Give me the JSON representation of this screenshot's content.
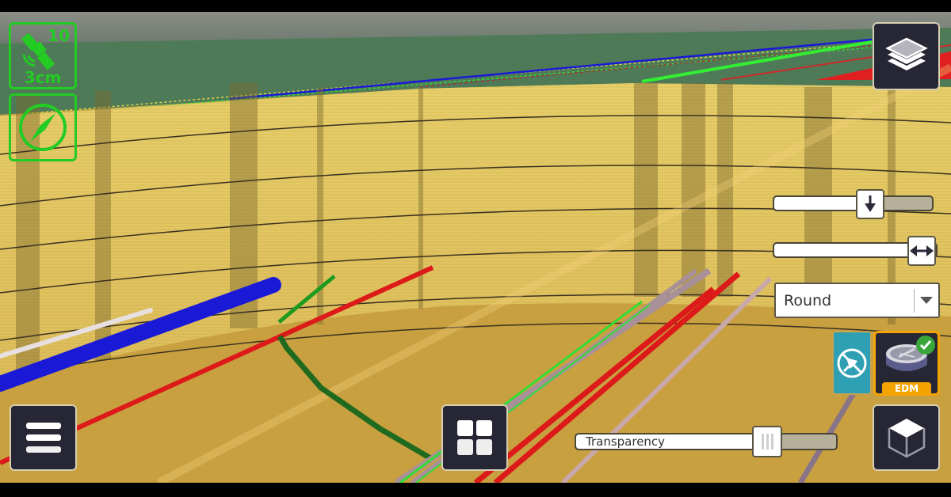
{
  "app": {
    "type": "AR utility viewer",
    "view_mode": "excavation view"
  },
  "status": {
    "satellite_count": "10",
    "gps_accuracy": "3cm",
    "gps_icon": "satellite-icon",
    "compass_icon": "compass-icon",
    "hud_color": "#22cc22"
  },
  "controls": {
    "layers_icon": "layers-icon",
    "menu_icon": "hamburger-menu-icon",
    "grid_icon": "grid-icon",
    "cube_icon": "cube-icon",
    "depth_slider": {
      "icon": "arrow-down-icon",
      "value_fraction": 0.6
    },
    "width_slider": {
      "icon": "arrow-left-right-icon",
      "value_fraction": 1.0
    },
    "shape_dropdown": {
      "selected": "Round"
    },
    "snap_toggle": {
      "icon": "no-pin-icon",
      "color": "#2fa0b3"
    },
    "edm_button": {
      "label": "EDM",
      "active": true,
      "accent": "#f5a300",
      "check_color": "#3aa63a"
    },
    "transparency_slider": {
      "label": "Transparency",
      "value_fraction": 0.72
    }
  },
  "utility_colors": {
    "water": "#1a1ad6",
    "electric": "#dd1a1a",
    "gas_light": "#33dd33",
    "gas_dark": "#1f7a1f",
    "telecom": "#a89098",
    "misc": "#e0d8d8"
  }
}
